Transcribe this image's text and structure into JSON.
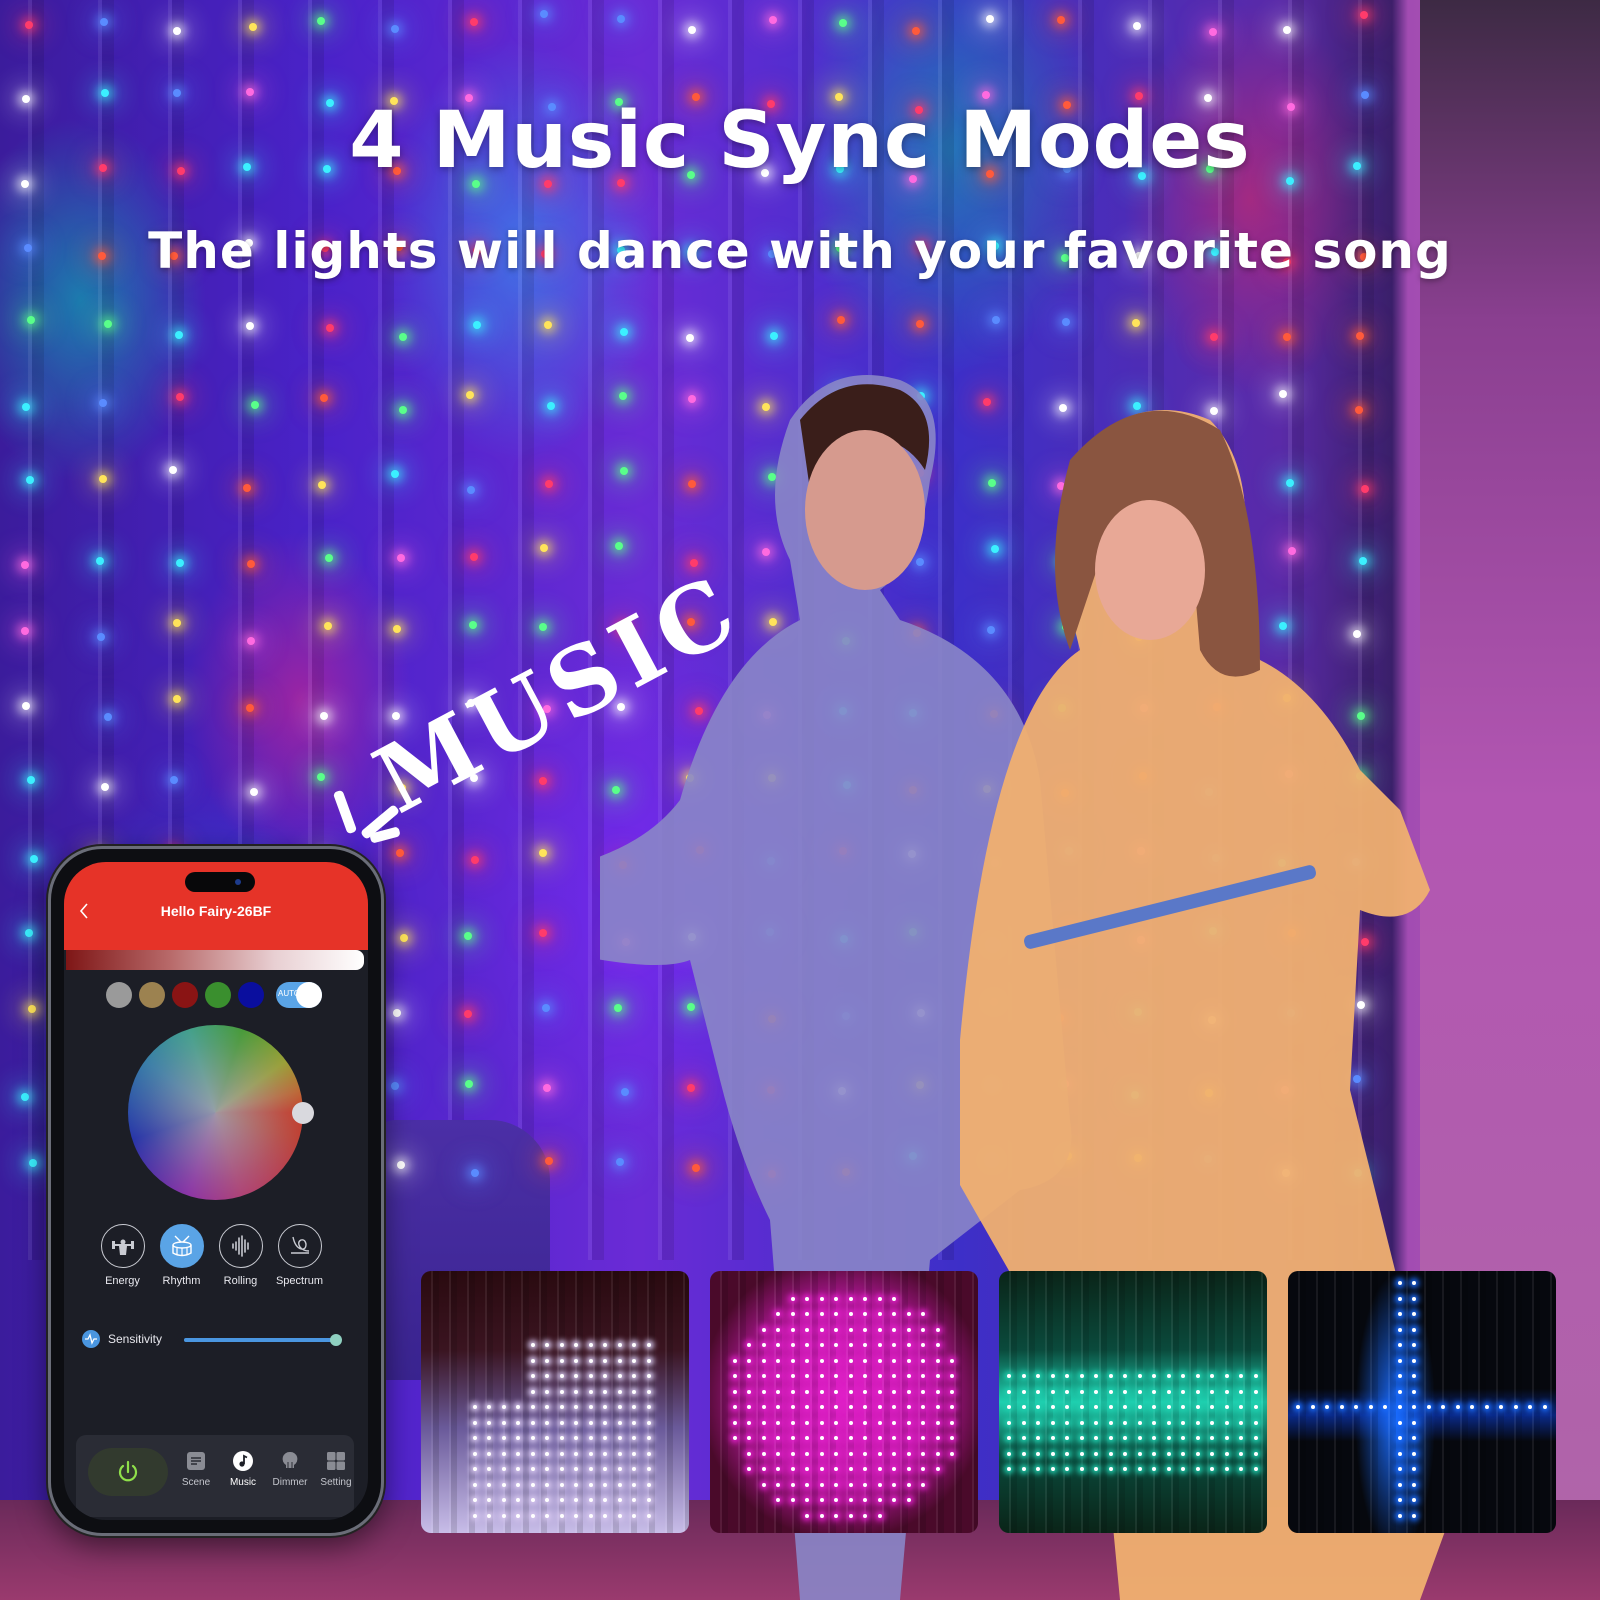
{
  "banner": {
    "headline": "4 Music Sync Modes",
    "subheadline": "The lights will dance with your favorite song",
    "decorative_word": "MUSIC"
  },
  "phone_app": {
    "header": {
      "title": "Hello Fairy-26BF",
      "back_icon": "chevron-left-icon",
      "header_color": "#e63328"
    },
    "brightness_gradient": [
      "#7e1616",
      "#ffffff"
    ],
    "color_presets": [
      {
        "name": "gray",
        "color": "#9a9a9a"
      },
      {
        "name": "tan",
        "color": "#9c8250"
      },
      {
        "name": "dark-red",
        "color": "#8a1414"
      },
      {
        "name": "green",
        "color": "#3a8f2e"
      },
      {
        "name": "blue",
        "color": "#0a0e9e"
      }
    ],
    "auto_toggle": {
      "label": "AUTO",
      "on": true,
      "color": "#5aa4e6"
    },
    "color_wheel": {
      "selected_hue": "red",
      "handle_icon": "wheel-handle"
    },
    "music_modes": [
      {
        "label": "Energy",
        "icon": "weightlifter-icon",
        "active": false
      },
      {
        "label": "Rhythm",
        "icon": "drum-icon",
        "active": true
      },
      {
        "label": "Rolling",
        "icon": "soundwave-icon",
        "active": false
      },
      {
        "label": "Spectrum",
        "icon": "spectrum-loop-icon",
        "active": false
      }
    ],
    "sensitivity": {
      "label": "Sensitivity",
      "icon": "pulse-icon",
      "value_fraction": 1.0
    },
    "bottom_nav": {
      "power_icon": "power-icon",
      "items": [
        {
          "label": "Scene",
          "icon": "scene-list-icon",
          "active": false
        },
        {
          "label": "Music",
          "icon": "music-note-icon",
          "active": true
        },
        {
          "label": "Dimmer",
          "icon": "bulb-icon",
          "active": false
        },
        {
          "label": "Setting",
          "icon": "grid-icon",
          "active": false
        }
      ]
    }
  },
  "mode_previews": [
    {
      "name": "energy-preview",
      "main_color": "#d8c8f0",
      "bg": "#2a0a10"
    },
    {
      "name": "rhythm-preview",
      "main_color": "#e020c8",
      "bg": "#4a0a2a"
    },
    {
      "name": "rolling-preview",
      "main_color": "#20d0b0",
      "bg": "#0a2418"
    },
    {
      "name": "spectrum-preview",
      "main_color": "#1a6cff",
      "bg": "#06080e"
    }
  ]
}
